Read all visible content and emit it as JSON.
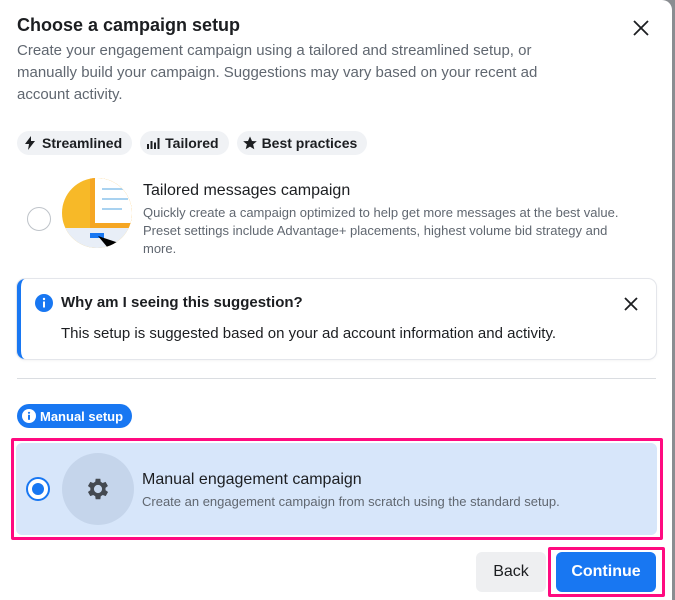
{
  "dialog": {
    "title": "Choose a campaign setup",
    "subtitle": "Create your engagement campaign using a tailored and streamlined setup, or manually build your campaign. Suggestions may vary based on your recent ad account activity.",
    "close_icon": "close-icon"
  },
  "chips": [
    {
      "label": "Streamlined",
      "icon": "lightning-icon"
    },
    {
      "label": "Tailored",
      "icon": "bar-chart-icon"
    },
    {
      "label": "Best practices",
      "icon": "star-icon"
    }
  ],
  "tailored_option": {
    "title": "Tailored messages campaign",
    "description": "Quickly create a campaign optimized to help get more messages at the best value. Preset settings include Advantage+ placements, highest volume bid strategy and more.",
    "selected": false
  },
  "notice": {
    "title": "Why am I seeing this suggestion?",
    "text": "This setup is suggested based on your ad account information and activity."
  },
  "manual_badge": {
    "label": "Manual setup"
  },
  "manual_option": {
    "title": "Manual engagement campaign",
    "description": "Create an engagement campaign from scratch using the standard setup.",
    "selected": true
  },
  "footer": {
    "back_label": "Back",
    "continue_label": "Continue"
  },
  "colors": {
    "accent": "#1877f2",
    "highlight": "#ff0a80",
    "selected_bg": "#d7e6fa"
  }
}
